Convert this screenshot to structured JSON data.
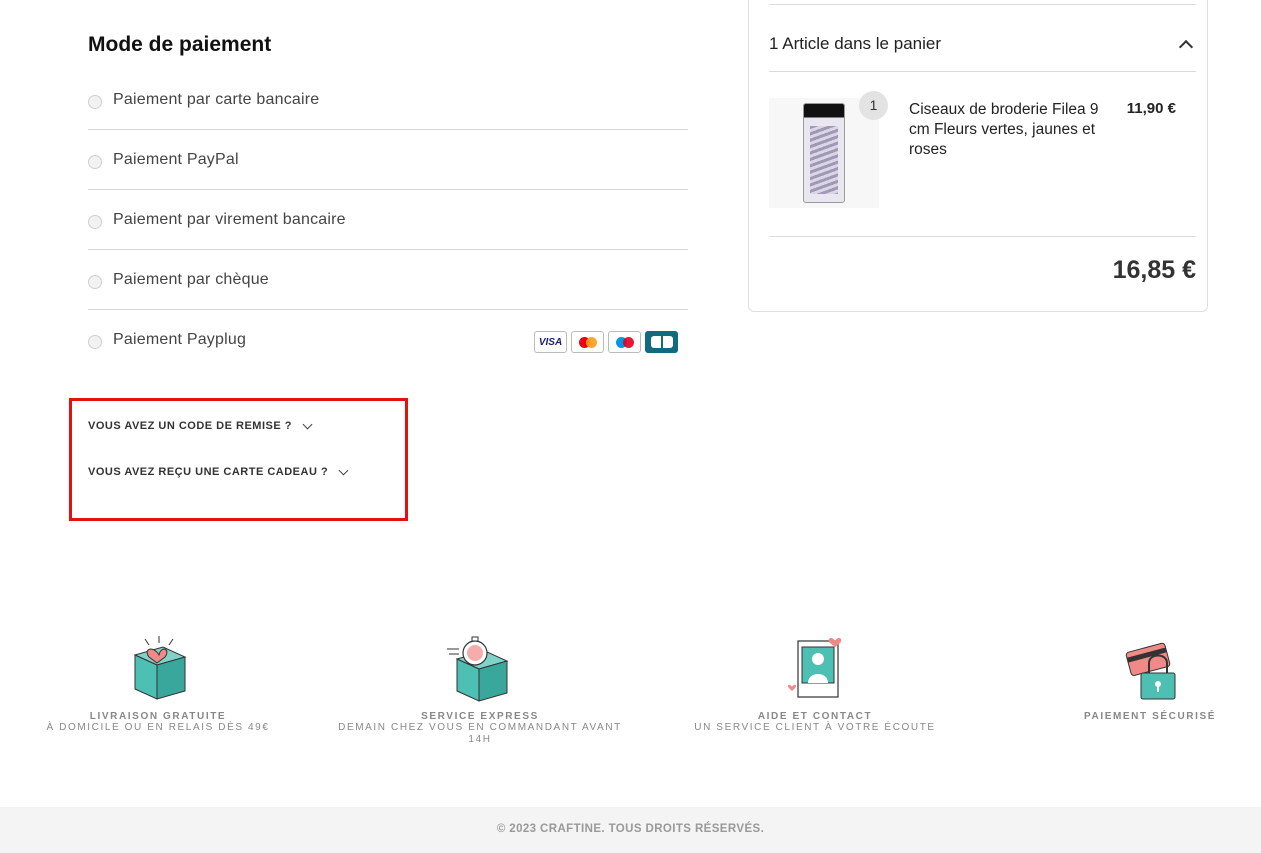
{
  "payment": {
    "title": "Mode de paiement",
    "options": [
      {
        "label": "Paiement par carte bancaire"
      },
      {
        "label": "Paiement PayPal"
      },
      {
        "label": "Paiement par virement bancaire"
      },
      {
        "label": "Paiement par chèque"
      },
      {
        "label": "Paiement Payplug"
      }
    ],
    "card_logos": [
      "VISA",
      "mastercard",
      "maestro",
      "CB"
    ]
  },
  "promo": {
    "code_label": "VOUS AVEZ UN CODE DE REMISE ?",
    "gift_label": "VOUS AVEZ REÇU UNE CARTE CADEAU ?"
  },
  "cart": {
    "header": "1 Article dans le panier",
    "item": {
      "quantity": "1",
      "name": "Ciseaux de broderie Filea 9 cm Fleurs vertes, jaunes et roses",
      "price": "11,90 €"
    },
    "total": "16,85 €"
  },
  "reassurance": [
    {
      "title": "LIVRAISON GRATUITE",
      "subtitle": "À DOMICILE OU EN RELAIS DÈS 49€",
      "icon": "gift-box-heart-icon"
    },
    {
      "title": "SERVICE EXPRESS",
      "subtitle": "DEMAIN CHEZ VOUS EN COMMANDANT AVANT 14H",
      "icon": "express-box-stopwatch-icon"
    },
    {
      "title": "AIDE ET CONTACT",
      "subtitle": "UN SERVICE CLIENT À VOTRE ÉCOUTE",
      "icon": "contact-portrait-icon"
    },
    {
      "title": "PAIEMENT SÉCURISÉ",
      "subtitle": "",
      "icon": "secure-card-lock-icon"
    }
  ],
  "footer": {
    "copyright": "© 2023 CRAFTINE. TOUS DROITS RÉSERVÉS."
  },
  "colors": {
    "teal": "#4dbfb3",
    "pink": "#ef8a86",
    "highlight": "#e01212"
  }
}
